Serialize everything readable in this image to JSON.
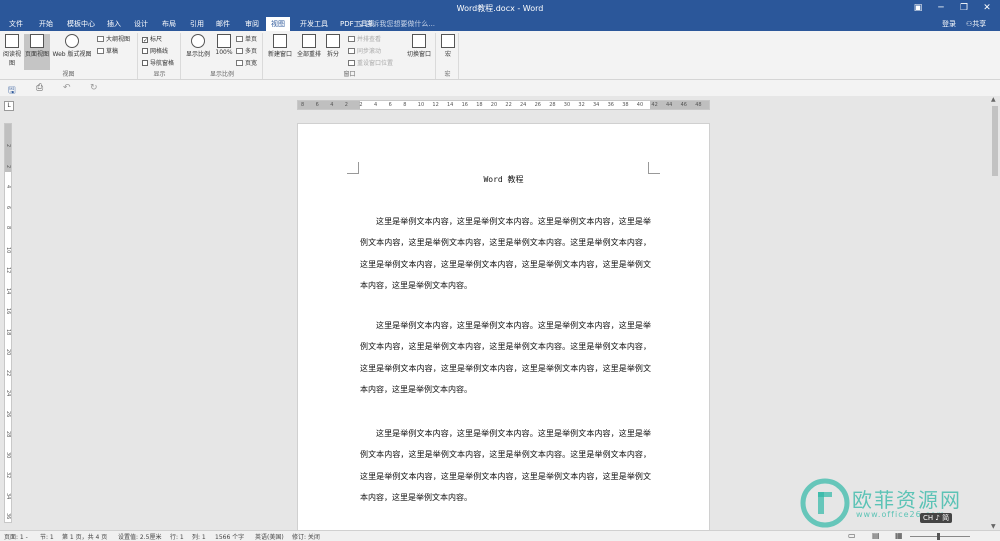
{
  "titlebar": {
    "title": "Word教程.docx - Word",
    "help": "▣",
    "minimize": "─",
    "restore": "❐",
    "close": "✕"
  },
  "menu": {
    "items": [
      "文件",
      "开始",
      "模板中心",
      "插入",
      "设计",
      "布局",
      "引用",
      "邮件",
      "审阅",
      "视图",
      "开发工具",
      "PDF工具集"
    ],
    "active": "视图",
    "tellme": "告诉我您想要做什么...",
    "login": "登录",
    "share": "共享"
  },
  "ribbon": {
    "views": {
      "label": "视图",
      "read": "阅读视图",
      "print": "页面视图",
      "web": "Web 版式视图",
      "outline": "大纲视图",
      "draft": "草稿"
    },
    "show": {
      "label": "显示",
      "ruler": "标尺",
      "gridlines": "网格线",
      "navpane": "导航窗格"
    },
    "zoom": {
      "label": "显示比例",
      "zoom": "显示比例",
      "hundred": "100%",
      "single": "单页",
      "multi": "多页",
      "width": "页宽"
    },
    "window": {
      "label": "窗口",
      "new": "新建窗口",
      "arrange": "全部重排",
      "split": "拆分",
      "side": "并排查看",
      "sync": "同步滚动",
      "reset": "重设窗口位置",
      "switch": "切换窗口"
    },
    "macro": {
      "label": "宏",
      "macros": "宏"
    }
  },
  "qat": {
    "save": "🖫",
    "preview": "⎙",
    "undo": "↶",
    "redo": "↻",
    "ruler_btn": "L"
  },
  "hruler": [
    "8",
    "6",
    "4",
    "2",
    "2",
    "4",
    "6",
    "8",
    "10",
    "12",
    "14",
    "16",
    "18",
    "20",
    "22",
    "24",
    "26",
    "28",
    "30",
    "32",
    "34",
    "36",
    "38",
    "40",
    "42",
    "44",
    "46",
    "48"
  ],
  "vruler": [
    "2",
    "2",
    "4",
    "6",
    "8",
    "10",
    "12",
    "14",
    "16",
    "18",
    "20",
    "22",
    "24",
    "26",
    "28",
    "30",
    "32",
    "34",
    "36"
  ],
  "document": {
    "header": "Word 教程",
    "paragraphs": [
      "这里是举例文本内容，这里是举例文本内容。这里是举例文本内容，这里是举例文本内容，这里是举例文本内容，这里是举例文本内容。这里是举例文本内容，这里是举例文本内容，这里是举例文本内容，这里是举例文本内容，这里是举例文本内容，这里是举例文本内容。",
      "这里是举例文本内容，这里是举例文本内容。这里是举例文本内容，这里是举例文本内容，这里是举例文本内容，这里是举例文本内容。这里是举例文本内容，这里是举例文本内容，这里是举例文本内容，这里是举例文本内容，这里是举例文本内容，这里是举例文本内容。",
      "这里是举例文本内容，这里是举例文本内容。这里是举例文本内容，这里是举例文本内容，这里是举例文本内容，这里是举例文本内容。这里是举例文本内容，这里是举例文本内容，这里是举例文本内容，这里是举例文本内容，这里是举例文本内容，这里是举例文本内容。"
    ]
  },
  "status": {
    "section_page": "页面: 1 -",
    "section": "节: 1",
    "page": "第 1 页，共 4 页",
    "setting": "设置值: 2.5厘米",
    "row": "行: 1",
    "col": "列: 1",
    "words": "1566 个字",
    "lang": "英语(美国)",
    "track": "修订: 关闭"
  },
  "watermark": {
    "brand": "欧菲资源网",
    "url": "www.office26.com",
    "brand_color": "#2fb8a6"
  },
  "ime": "CH ♪ 简"
}
